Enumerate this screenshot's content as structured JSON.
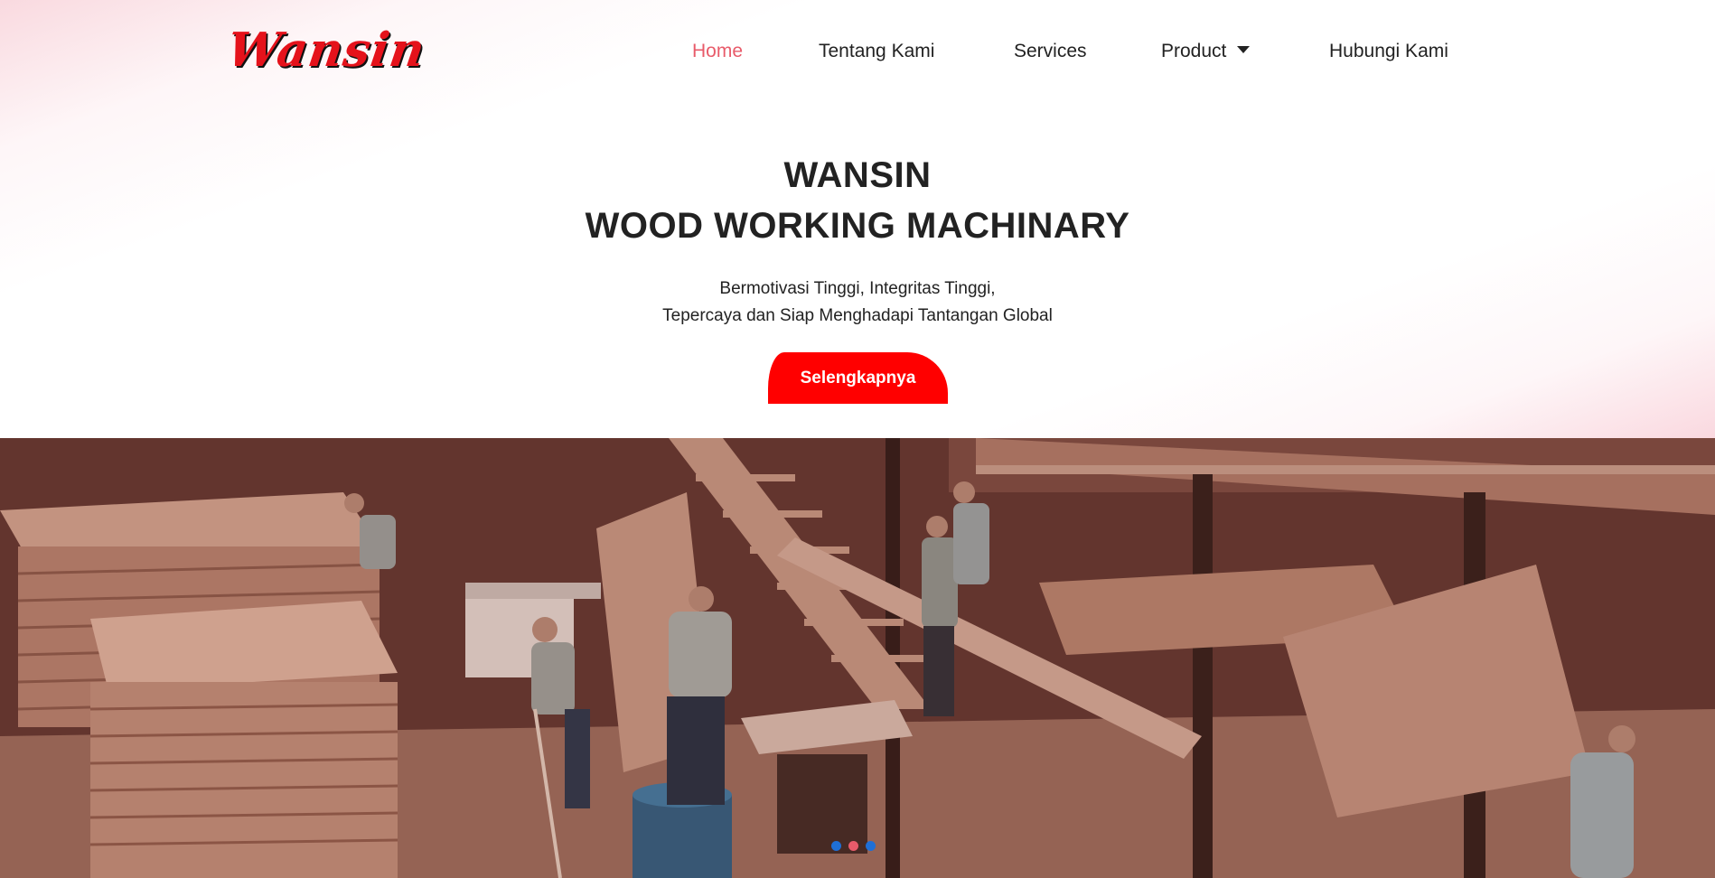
{
  "brand": {
    "logo_text": "Wansin",
    "accent_color": "#ff0000"
  },
  "nav": {
    "items": [
      {
        "label": "Home",
        "active": true
      },
      {
        "label": "Tentang Kami"
      },
      {
        "label": "Services"
      },
      {
        "label": "Product",
        "has_dropdown": true
      },
      {
        "label": "Hubungi Kami"
      }
    ]
  },
  "hero": {
    "title_line1": "WANSIN",
    "title_line2": "WOOD WORKING MACHINARY",
    "subtitle_line1": "Bermotivasi Tinggi, Integritas Tinggi,",
    "subtitle_line2": "Tepercaya dan Siap Menghadapi Tantangan Global",
    "cta_label": "Selengkapnya"
  },
  "slider": {
    "slide_count": 3,
    "active_index": 1
  },
  "icons": {
    "dropdown": "caret-down-icon"
  }
}
